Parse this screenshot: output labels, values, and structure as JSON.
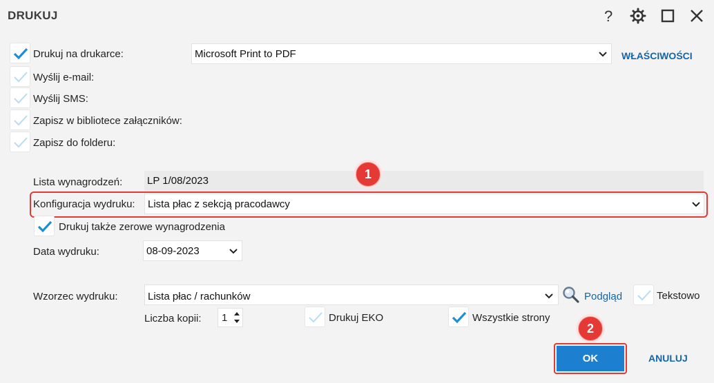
{
  "window": {
    "title": "DRUKUJ",
    "help_glyph": "?",
    "icons": [
      "help-icon",
      "gear-icon",
      "maximize-icon",
      "close-icon"
    ]
  },
  "output_options": [
    {
      "label": "Drukuj na drukarce:",
      "checked": true
    },
    {
      "label": "Wyślij e-mail:",
      "checked": false
    },
    {
      "label": "Wyślij SMS:",
      "checked": false
    },
    {
      "label": "Zapisz w bibliotece załączników:",
      "checked": false
    },
    {
      "label": "Zapisz do folderu:",
      "checked": false
    }
  ],
  "printer": {
    "selected": "Microsoft Print to PDF",
    "properties_link": "WŁAŚCIWOŚCI"
  },
  "payroll": {
    "label": "Lista wynagrodzeń:",
    "value": "LP 1/08/2023"
  },
  "print_config": {
    "label": "Konfiguracja wydruku:",
    "selected": "Lista płac z sekcją pracodawcy"
  },
  "zero_salaries": {
    "label": "Drukuj także zerowe wynagrodzenia",
    "checked": true
  },
  "print_date": {
    "label": "Data wydruku:",
    "value": "08-09-2023"
  },
  "template": {
    "label": "Wzorzec wydruku:",
    "selected": "Lista płac / rachunków",
    "preview_link": "Podgląd",
    "text_mode": {
      "label": "Tekstowo",
      "checked": false
    }
  },
  "copies": {
    "label": "Liczba kopii:",
    "value": "1"
  },
  "print_eko": {
    "label": "Drukuj EKO",
    "checked": false
  },
  "all_pages": {
    "label": "Wszystkie strony",
    "checked": true
  },
  "annotations": {
    "badge_1": "1",
    "badge_2": "2"
  },
  "buttons": {
    "ok": "OK",
    "cancel": "ANULUJ"
  },
  "colors": {
    "accent": "#1c7fd0",
    "link": "#1565a8",
    "highlight": "#e53935",
    "check_active": "#1b8fd6",
    "check_inactive": "#b7dcf3"
  }
}
